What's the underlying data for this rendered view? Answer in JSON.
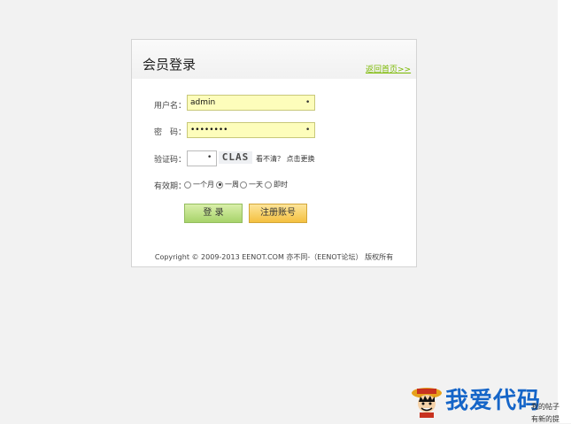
{
  "login": {
    "title": "会员登录",
    "back_link": "返回首页>>",
    "username_label": "用户名：",
    "username_value": "admin",
    "password_label": "密　码：",
    "password_value": "••••••••",
    "captcha_label": "验证码：",
    "captcha_text": "CLAS",
    "captcha_refresh": "看不清？ 点击更换",
    "remember_label": "有效期：",
    "remember_options": [
      "一个月",
      "一周",
      "一天",
      "即时"
    ],
    "remember_selected": "一周",
    "login_button": "登 录",
    "register_button": "注册账号",
    "copyright": "Copyright © 2009-2013 EENOT.COM 亦不同-（EENOT论坛） 版权所有"
  },
  "brand": {
    "text": "我爱代码",
    "notif_1": "我的帖子",
    "notif_2": "有新的提"
  },
  "colors": {
    "accent": "#7ab800",
    "field_bg": "#fdfdbb",
    "brand": "#1565c8"
  }
}
